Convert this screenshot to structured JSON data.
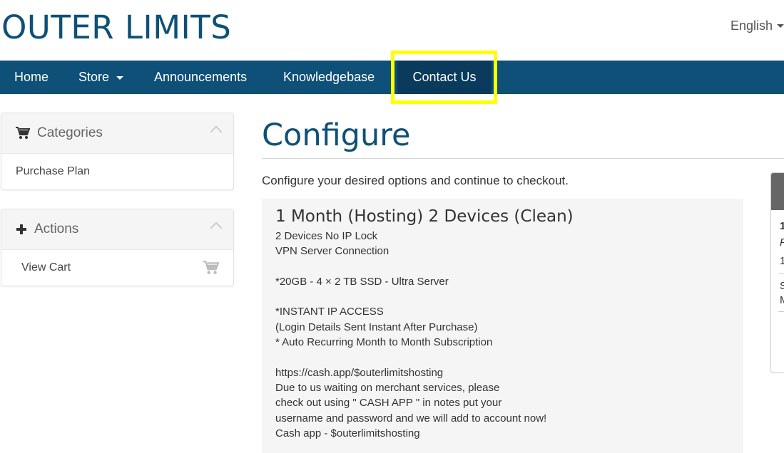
{
  "brand": "OUTER LIMITS",
  "language": {
    "label": "English"
  },
  "nav": {
    "home": "Home",
    "store": "Store",
    "announcements": "Announcements",
    "knowledgebase": "Knowledgebase",
    "contact": "Contact Us"
  },
  "sidebar": {
    "categories": {
      "title": "Categories",
      "items": [
        "Purchase Plan"
      ]
    },
    "actions": {
      "title": "Actions",
      "items": [
        "View Cart"
      ]
    }
  },
  "main": {
    "title": "Configure",
    "intro": "Configure your desired options and continue to checkout.",
    "product": {
      "name": "1 Month (Hosting) 2 Devices (Clean)",
      "description": [
        "2 Devices No IP Lock",
        "VPN Server Connection",
        "",
        "*20GB - 4 × 2 TB SSD - Ultra Server",
        "",
        "*INSTANT IP ACCESS",
        "(Login Details Sent Instant After Purchase)",
        "* Auto Recurring Month to Month Subscription",
        "",
        "https://cash.app/$outerlimitshosting",
        "Due to us waiting on merchant services, please",
        "check out using \" CASH APP \" in notes put your",
        "username and password and we will add to account now!",
        "Cash app - $outerlimitshosting"
      ]
    }
  },
  "summary": {
    "line1": "1",
    "line2": "F",
    "line3": "1",
    "line4": "S",
    "line5": "M"
  },
  "colors": {
    "brand": "#0e5077",
    "nav_active": "#0a3a5c",
    "highlight": "#ffff00"
  }
}
